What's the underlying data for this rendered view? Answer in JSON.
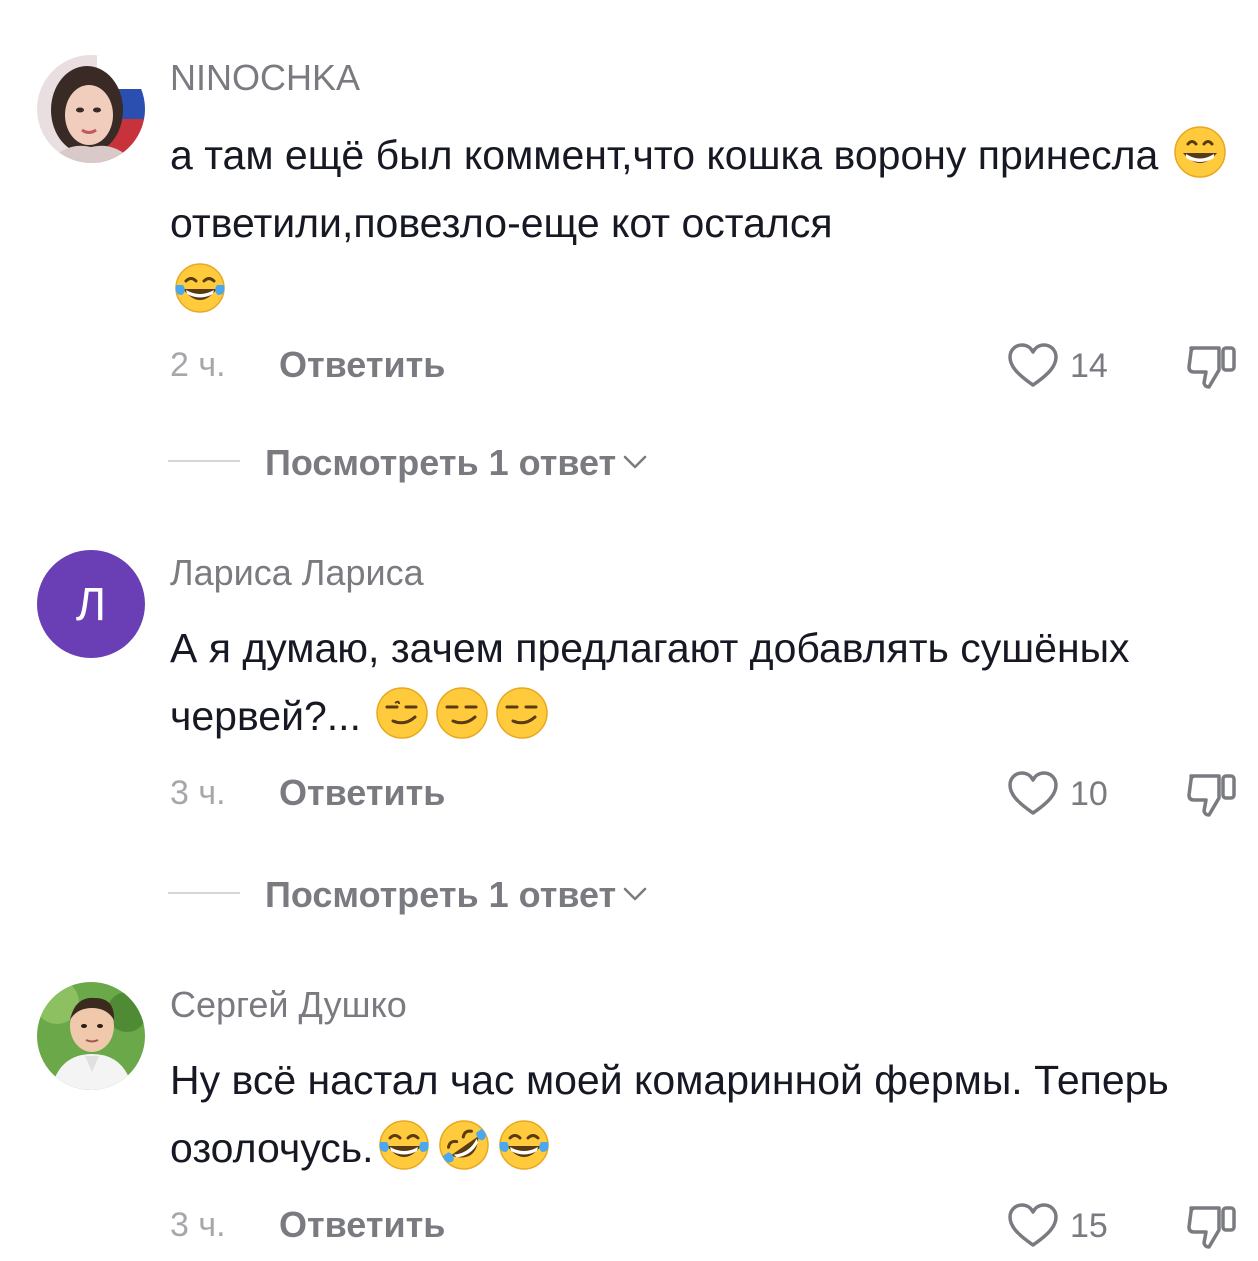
{
  "comments": [
    {
      "username": "NINOCHKA",
      "avatar": "user-photo-avatar",
      "text_parts": [
        "а там ещё был коммент,что кошка ворону принесла ",
        "ответили,повезло-еще кот остался"
      ],
      "emojis": [
        "grinning-face-emoji",
        "tears-of-joy-emoji"
      ],
      "time": "2 ч.",
      "reply_label": "Ответить",
      "likes": "14",
      "view_replies": "Посмотреть 1 ответ"
    },
    {
      "username": "Лариса Лариса",
      "avatar_letter": "Л",
      "avatar_color": "#6a3fb5",
      "text_parts": [
        "А я думаю, зачем предлагают добавлять сушёных червей?... "
      ],
      "emojis": [
        "smirking-face-emoji",
        "smirking-face-emoji",
        "smirking-face-emoji"
      ],
      "time": "3 ч.",
      "reply_label": "Ответить",
      "likes": "10",
      "view_replies": "Посмотреть 1 ответ"
    },
    {
      "username": "Сергей Душко",
      "avatar": "user-photo-avatar",
      "text_parts": [
        "Ну всё настал час моей комаринной фермы. Теперь озолочусь."
      ],
      "emojis": [
        "tears-of-joy-emoji",
        "rolling-on-floor-laughing-emoji",
        "tears-of-joy-emoji"
      ],
      "time": "3 ч.",
      "reply_label": "Ответить",
      "likes": "15"
    }
  ],
  "icons": {
    "like": "heart-outline-icon",
    "dislike": "thumbs-down-outline-icon",
    "expand": "chevron-down-icon"
  },
  "colors": {
    "text": "#161823",
    "secondary": "#7a7b80",
    "muted": "#a6a7ab"
  }
}
